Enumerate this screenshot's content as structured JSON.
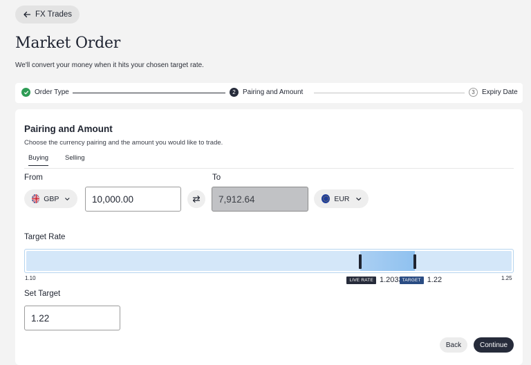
{
  "nav": {
    "back_label": "FX Trades"
  },
  "page": {
    "title": "Market Order",
    "subtitle": "We'll convert your money when it hits your chosen target rate."
  },
  "steps": [
    {
      "number": "1",
      "label": "Order Type",
      "state": "complete"
    },
    {
      "number": "2",
      "label": "Pairing and Amount",
      "state": "current"
    },
    {
      "number": "3",
      "label": "Expiry Date",
      "state": "upcoming"
    }
  ],
  "section": {
    "title": "Pairing and Amount",
    "subtitle": "Choose the currency pairing and the amount you would like to trade."
  },
  "tabs": [
    {
      "label": "Buying",
      "active": true
    },
    {
      "label": "Selling",
      "active": false
    }
  ],
  "from": {
    "label": "From",
    "currency": "GBP",
    "amount": "10,000.00"
  },
  "to": {
    "label": "To",
    "currency": "EUR",
    "amount": "7,912.64"
  },
  "target_rate": {
    "label": "Target Rate",
    "min": "1.10",
    "max": "1.25",
    "min_value": 1.1,
    "max_value": 1.25,
    "live_tag": "LIVE RATE",
    "live_value": "1.2033",
    "live_numeric": 1.2033,
    "target_tag": "TARGET",
    "target_value": "1.22",
    "target_numeric": 1.22
  },
  "set_target": {
    "label": "Set Target",
    "value": "1.22"
  },
  "actions": {
    "back_label": "Back",
    "continue_label": "Continue"
  },
  "colors": {
    "primary_dark": "#262b3a",
    "success": "#2e9c55",
    "target_tag": "#2a4c83",
    "slider_track": "#d4e7f9",
    "slider_range": "#8fc1ef"
  },
  "icons": {
    "back": "arrow-left-icon",
    "check": "check-icon",
    "swap": "swap-arrows-icon",
    "chevron": "chevron-down-icon",
    "spinner": "loading-spinner-icon"
  }
}
